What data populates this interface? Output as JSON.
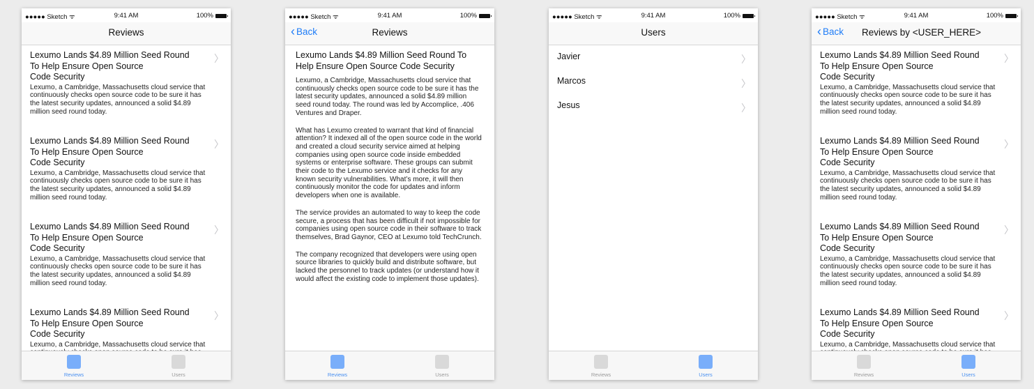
{
  "status_bar": {
    "carrier": "●●●●● Sketch ᯤ",
    "time": "9:41 AM",
    "battery": "100%"
  },
  "back_label": "Back",
  "tabs": {
    "reviews": "Reviews",
    "users": "Users"
  },
  "screens": {
    "reviews_list": {
      "title": "Reviews"
    },
    "review_detail": {
      "title": "Reviews"
    },
    "users_list": {
      "title": "Users"
    },
    "user_reviews": {
      "title": "Reviews by <USER_HERE>"
    }
  },
  "review": {
    "title_line1": "Lexumo Lands $4.89 Million Seed Round",
    "title_line2": "To Help Ensure Open Source",
    "title_line3": "Code Security",
    "snippet": "Lexumo, a Cambridge, Massachusetts cloud service that continuously checks open source code to be sure it has the latest security updates, announced a solid $4.89 million seed round today."
  },
  "article": {
    "title": "Lexumo Lands $4.89 Million Seed Round To Help Ensure Open Source Code Security",
    "paragraphs": [
      "Lexumo, a Cambridge, Massachusetts cloud service that continuously checks open source code to be sure it has the latest security updates, announced a solid $4.89 million seed round today. The round was led by Accomplice, .406 Ventures and Draper.",
      "What has Lexumo created to warrant that kind of financial attention? It indexed all of the open source code in the world and created a cloud security service aimed at  helping companies using open source code inside embedded systems or enterprise software. These groups can submit their code to the Lexumo service and it checks for any known security vulnerabilities. What’s more, it will then continuously monitor the code for updates and inform developers when one is available.",
      "The service provides an automated to way to keep the code secure, a process that has been difficult if not impossible for companies using open source code in their software to track themselves, Brad Gaynor, CEO at Lexumo told TechCrunch.",
      "The company recognized that developers were using open source libraries to quickly build and distribute software, but lacked the personnel to track updates (or understand how it would affect the existing code to implement those updates)."
    ]
  },
  "users": [
    "Javier",
    "Marcos",
    "Jesus"
  ],
  "colors": {
    "accent": "#1e7cf7",
    "active_tab": "#79aefa",
    "inactive_tab": "#d9d9d9"
  }
}
